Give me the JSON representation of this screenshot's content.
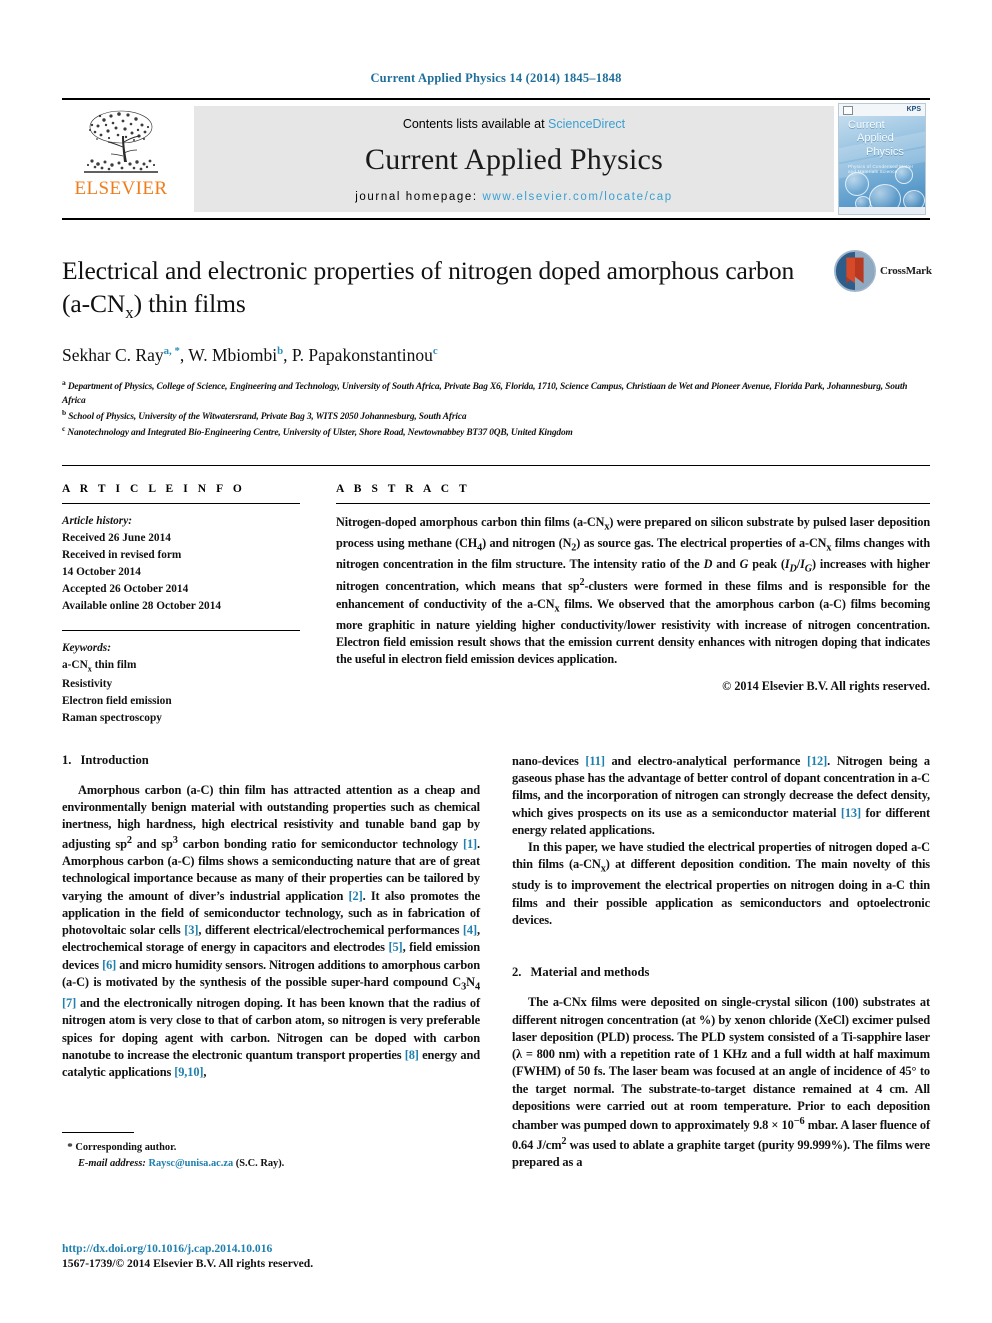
{
  "running_head": "Current Applied Physics 14 (2014) 1845–1848",
  "masthead": {
    "publisher_name": "ELSEVIER",
    "publisher_logo_icon": "elsevier-tree-icon",
    "contents_prefix": "Contents lists available at",
    "contents_link": "ScienceDirect",
    "journal_title": "Current Applied Physics",
    "homepage_prefix": "journal homepage:",
    "homepage_url": "www.elsevier.com/locate/cap",
    "cover": {
      "line1": "Current",
      "line2": "Applied",
      "line3": "Physics",
      "subtitle": "Physics of Condensed Matter and Materials Science",
      "society_mark": "KPS",
      "publisher_mark_icon": "elsevier-mark-icon"
    }
  },
  "article": {
    "title_part1": "Electrical and electronic properties of nitrogen doped amorphous carbon (a-CN",
    "title_sub": "x",
    "title_part2": ") thin films",
    "crossmark_label": "CrossMark",
    "crossmark_icon": "crossmark-icon",
    "authors": [
      {
        "name": "Sekhar C. Ray",
        "marks": "a, *"
      },
      {
        "name": "W. Mbiombi",
        "marks": "b"
      },
      {
        "name": "P. Papakonstantinou",
        "marks": "c"
      }
    ],
    "affiliations": [
      {
        "mark": "a",
        "text": "Department of Physics, College of Science, Engineering and Technology, University of South Africa, Private Bag X6, Florida, 1710, Science Campus, Christiaan de Wet and Pioneer Avenue, Florida Park, Johannesburg, South Africa"
      },
      {
        "mark": "b",
        "text": "School of Physics, University of the Witwatersrand, Private Bag 3, WITS 2050 Johannesburg, South Africa"
      },
      {
        "mark": "c",
        "text": "Nanotechnology and Integrated Bio-Engineering Centre, University of Ulster, Shore Road, Newtownabbey BT37 0QB, United Kingdom"
      }
    ]
  },
  "article_info": {
    "heading": "A R T I C L E    I N F O",
    "history_label": "Article history:",
    "history": [
      "Received 26 June 2014",
      "Received in revised form",
      "14 October 2014",
      "Accepted 26 October 2014",
      "Available online 28 October 2014"
    ],
    "keywords_label": "Keywords:",
    "keywords": [
      "a-CNx thin film",
      "Resistivity",
      "Electron field emission",
      "Raman spectroscopy"
    ]
  },
  "abstract": {
    "heading": "A B S T R A C T",
    "text": "Nitrogen-doped amorphous carbon thin films (a-CNx) were prepared on silicon substrate by pulsed laser deposition process using methane (CH4) and nitrogen (N2) as source gas. The electrical properties of a-CNx films changes with nitrogen concentration in the film structure. The intensity ratio of the D and G peak (ID/IG) increases with higher nitrogen concentration, which means that sp2-clusters were formed in these films and is responsible for the enhancement of conductivity of the a-CNx films. We observed that the amorphous carbon (a-C) films becoming more graphitic in nature yielding higher conductivity/lower resistivity with increase of nitrogen concentration. Electron field emission result shows that the emission current density enhances with nitrogen doping that indicates the useful in electron field emission devices application.",
    "copyright": "© 2014 Elsevier B.V. All rights reserved."
  },
  "sections": {
    "introduction_number": "1.",
    "introduction_title": "Introduction",
    "methods_number": "2.",
    "methods_title": "Material and methods",
    "intro_p1": "Amorphous carbon (a-C) thin film has attracted attention as a cheap and environmentally benign material with outstanding properties such as chemical inertness, high hardness, high electrical resistivity and tunable band gap by adjusting sp2 and sp3 carbon bonding ratio for semiconductor technology [1]. Amorphous carbon (a-C) films shows a semiconducting nature that are of great technological importance because as many of their properties can be tailored by varying the amount of diver's industrial application [2]. It also promotes the application in the field of semiconductor technology, such as in fabrication of photovoltaic solar cells [3], different electrical/electrochemical performances [4], electrochemical storage of energy in capacitors and electrodes [5], field emission devices [6] and micro humidity sensors. Nitrogen additions to amorphous carbon (a-C) is motivated by the synthesis of the possible super-hard compound C3N4 [7] and the electronically nitrogen doping. It has been known that the radius of nitrogen atom is very close to that of carbon atom, so nitrogen is very preferable spices for doping agent with carbon. Nitrogen can be doped with carbon nanotube to increase the electronic quantum transport properties [8] energy and catalytic applications [9,10], nano-devices [11] and electro-analytical performance [12]. Nitrogen being a gaseous phase has the advantage of better control of dopant concentration in a-C films, and the incorporation of nitrogen can strongly decrease the defect density, which gives prospects on its use as a semiconductor material [13] for different energy related applications.",
    "intro_p2": "In this paper, we have studied the electrical properties of nitrogen doped a-C thin films (a-CNx) at different deposition condition. The main novelty of this study is to improvement the electrical properties on nitrogen doing in a-C thin films and their possible application as semiconductors and optoelectronic devices.",
    "methods_p1": "The a-CNx films were deposited on single-crystal silicon (100) substrates at different nitrogen concentration (at %) by xenon chloride (XeCl) excimer pulsed laser deposition (PLD) process. The PLD system consisted of a Ti-sapphire laser (λ = 800 nm) with a repetition rate of 1 KHz and a full width at half maximum (FWHM) of 50 fs. The laser beam was focused at an angle of incidence of 45° to the target normal. The substrate-to-target distance remained at 4 cm. All depositions were carried out at room temperature. Prior to each deposition chamber was pumped down to approximately 9.8 × 10−6 mbar. A laser fluence of 0.64 J/cm2 was used to ablate a graphite target (purity 99.999%). The films were prepared as a"
  },
  "footnote": {
    "star": "*",
    "corresponding": "Corresponding author.",
    "email_label": "E-mail address:",
    "email": "Raysc@unisa.ac.za",
    "email_owner": "(S.C. Ray)."
  },
  "page_footer": {
    "doi": "http://dx.doi.org/10.1016/j.cap.2014.10.016",
    "issn_line": "1567-1739/© 2014 Elsevier B.V. All rights reserved."
  },
  "colors": {
    "link_blue": "#1f7fae",
    "sciencedirect_blue": "#3b9fd0",
    "elsevier_orange": "#f07d1b",
    "banner_gray": "#e6e6e6"
  }
}
